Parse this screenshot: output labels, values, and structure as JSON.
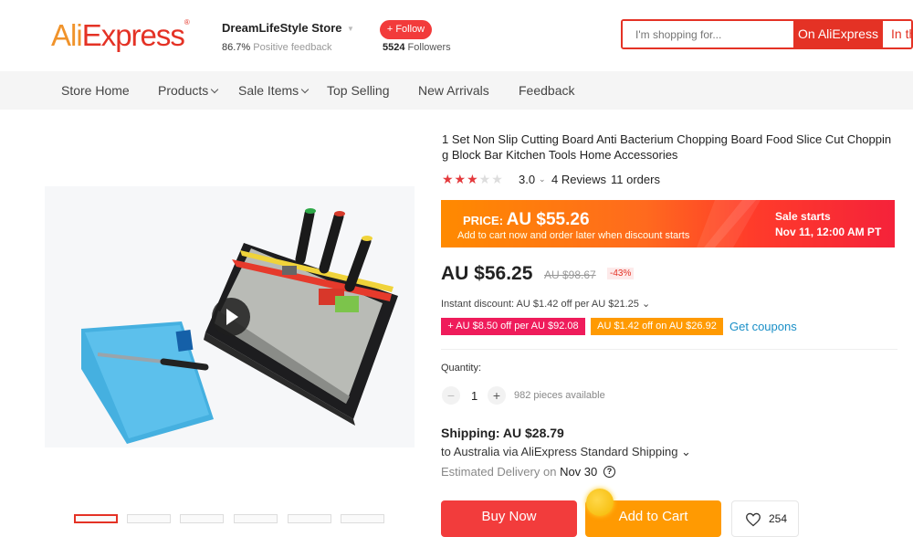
{
  "header": {
    "logo_text_a": "Ali",
    "logo_text_b": "Express",
    "logo_tm": "®",
    "store_name": "DreamLifeStyle Store",
    "feedback_pct": "86.7%",
    "feedback_label": " Positive feedback",
    "follow_label": "+ Follow",
    "followers_count": "5524",
    "followers_label": " Followers",
    "search_placeholder": "I'm shopping for...",
    "search_on_label": "On AliExpress",
    "search_in_label": "In th"
  },
  "nav": {
    "items": [
      {
        "label": "Store Home"
      },
      {
        "label": "Products"
      },
      {
        "label": "Sale Items"
      },
      {
        "label": "Top Selling"
      },
      {
        "label": "New Arrivals"
      },
      {
        "label": "Feedback"
      }
    ]
  },
  "product": {
    "title": "1 Set Non Slip Cutting Board Anti Bacterium Chopping Board Food Slice Cut Choppin g Block Bar Kitchen Tools Home Accessories",
    "rating_value": "3.0",
    "rating_stars": 3,
    "reviews": "4 Reviews",
    "orders": "11 orders",
    "sale_banner": {
      "price_label": "PRICE: ",
      "price_value": "AU $55.26",
      "subtitle": "Add to cart now and order later when discount starts",
      "sale_starts": "Sale starts",
      "sale_date": "Nov 11, 12:00 AM PT"
    },
    "price": "AU $56.25",
    "old_price": "AU $98.67",
    "discount": "-43%",
    "instant_discount": "Instant discount: AU $1.42 off per AU $21.25 ⌄",
    "coupons": [
      {
        "label": "+ AU $8.50 off per AU $92.08"
      },
      {
        "label": "AU $1.42 off on AU $26.92"
      }
    ],
    "get_coupons": "Get coupons",
    "quantity_label": "Quantity:",
    "quantity_value": "1",
    "minus": "−",
    "plus": "+",
    "availability": "982 pieces available",
    "shipping_title": "Shipping: AU $28.79",
    "shipping_dest": "to Australia via AliExpress Standard Shipping ⌄",
    "delivery_label": "Estimated Delivery on ",
    "delivery_date": "Nov 30",
    "help": "?",
    "buy_now": "Buy Now",
    "add_to_cart": "Add to Cart",
    "wish_count": "254"
  },
  "colors": {
    "brand_red": "#e43225",
    "brand_orange": "#ff9a02",
    "link_blue": "#1a8fc7"
  }
}
